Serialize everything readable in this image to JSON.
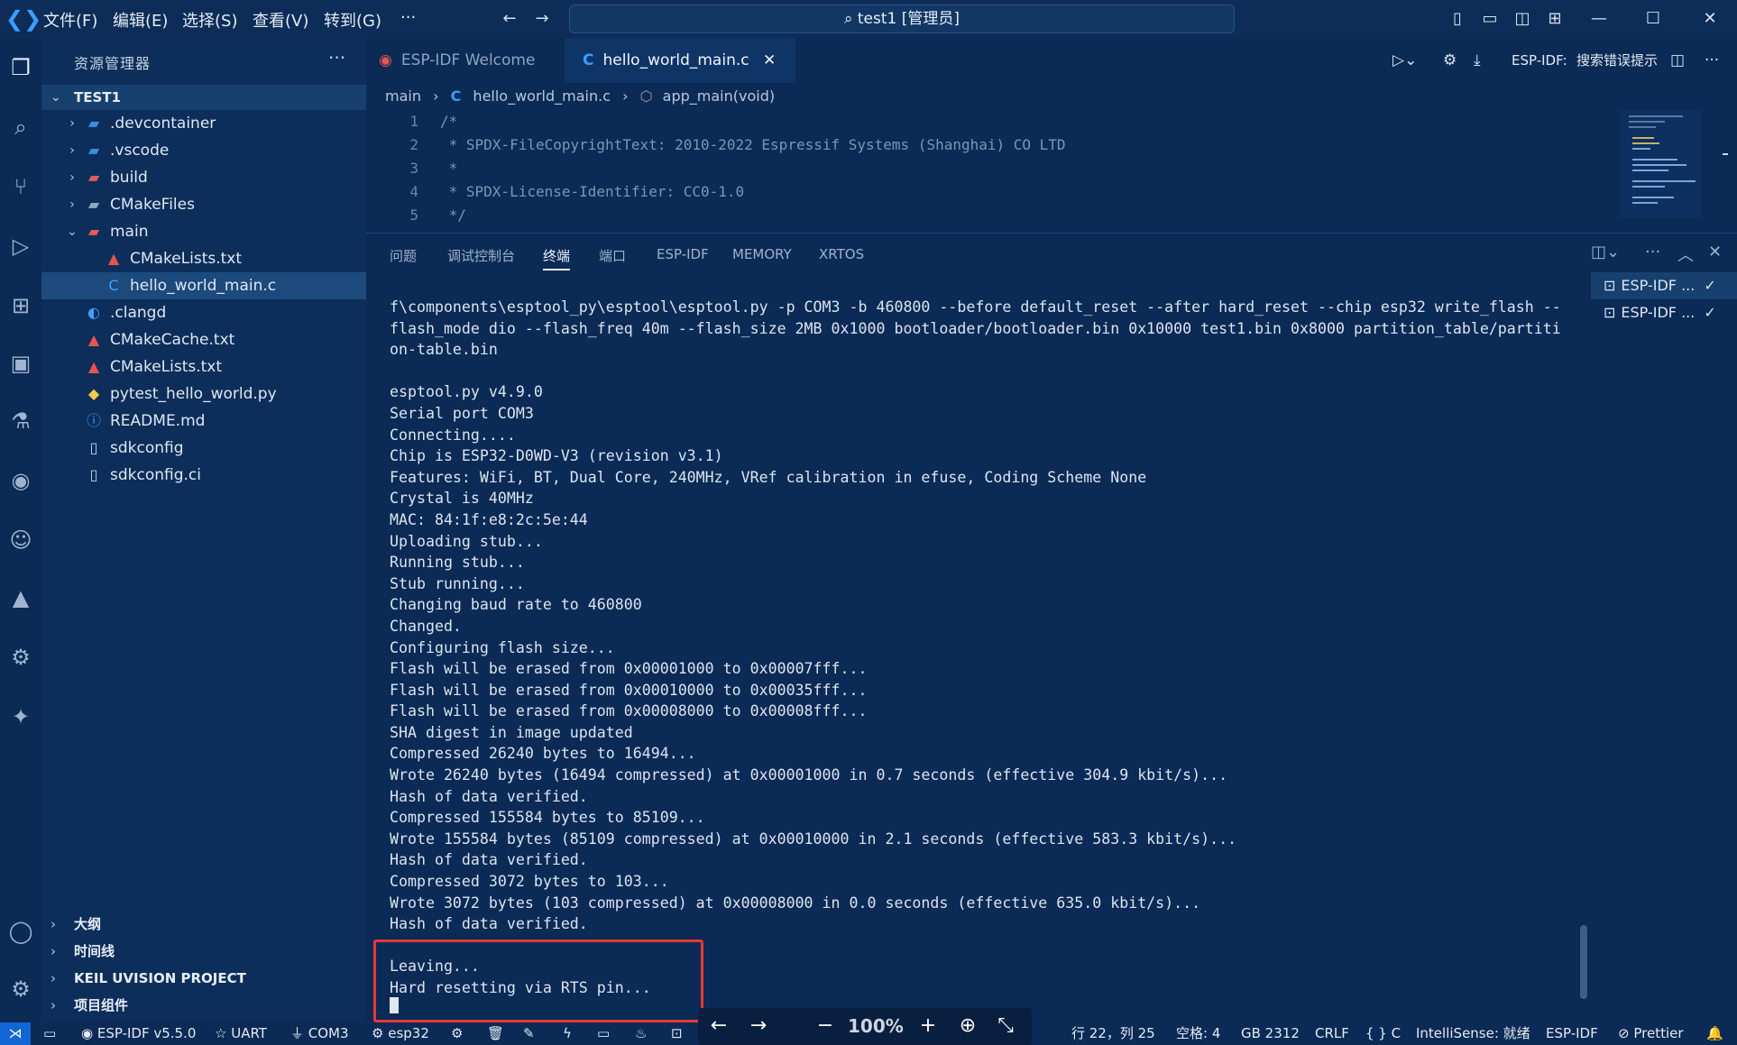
{
  "titlebar": {
    "menus": [
      "文件(F)",
      "编辑(E)",
      "选择(S)",
      "查看(V)",
      "转到(G)",
      "···"
    ],
    "search_text": "test1 [管理员]"
  },
  "sidebar": {
    "title": "资源管理器",
    "more": "···",
    "project": "TEST1",
    "tree": [
      {
        "label": ".devcontainer",
        "type": "folder",
        "icon": "devcontainer-folder-icon",
        "color": "#3b8de0"
      },
      {
        "label": ".vscode",
        "type": "folder",
        "icon": "vscode-folder-icon",
        "color": "#3b8de0"
      },
      {
        "label": "build",
        "type": "folder",
        "icon": "build-folder-icon",
        "color": "#e05b5b"
      },
      {
        "label": "CMakeFiles",
        "type": "folder",
        "icon": "folder-icon",
        "color": "#8fa6c4"
      },
      {
        "label": "main",
        "type": "folder-open",
        "icon": "main-folder-icon",
        "color": "#e05b5b"
      },
      {
        "label": "CMakeLists.txt",
        "type": "file-nested",
        "icon": "cmake-icon",
        "color": "#e8544e"
      },
      {
        "label": "hello_world_main.c",
        "type": "file-nested",
        "icon": "c-file-icon",
        "color": "#3aa0ff"
      },
      {
        "label": ".clangd",
        "type": "file",
        "icon": "clangd-icon",
        "color": "#3aa0ff"
      },
      {
        "label": "CMakeCache.txt",
        "type": "file",
        "icon": "cmake-icon",
        "color": "#e8544e"
      },
      {
        "label": "CMakeLists.txt",
        "type": "file",
        "icon": "cmake-icon",
        "color": "#e8544e"
      },
      {
        "label": "pytest_hello_world.py",
        "type": "file",
        "icon": "python-icon",
        "color": "#f2c94c"
      },
      {
        "label": "README.md",
        "type": "file",
        "icon": "info-icon",
        "color": "#3aa0ff"
      },
      {
        "label": "sdkconfig",
        "type": "file",
        "icon": "file-icon",
        "color": "#c5d2e3"
      },
      {
        "label": "sdkconfig.ci",
        "type": "file",
        "icon": "file-icon",
        "color": "#c5d2e3"
      }
    ],
    "sections": [
      "大纲",
      "时间线",
      "KEIL UVISION PROJECT",
      "项目组件"
    ]
  },
  "tabs": {
    "welcome": "ESP-IDF Welcome",
    "active": "hello_world_main.c",
    "right_label": "ESP-IDF:",
    "right_search": "搜索错误提示"
  },
  "breadcrumb": {
    "folder": "main",
    "file": "hello_world_main.c",
    "symbol": "app_main(void)"
  },
  "code": [
    {
      "n": "1",
      "text": "/*"
    },
    {
      "n": "2",
      "text": " * SPDX-FileCopyrightText: 2010-2022 Espressif Systems (Shanghai) CO LTD"
    },
    {
      "n": "3",
      "text": " *"
    },
    {
      "n": "4",
      "text": " * SPDX-License-Identifier: CC0-1.0"
    },
    {
      "n": "5",
      "text": " */"
    }
  ],
  "panel": {
    "tabs": [
      "问题",
      "调试控制台",
      "终端",
      "端口",
      "ESP-IDF",
      "MEMORY",
      "XRTOS"
    ],
    "active_tab": "终端",
    "terminals": [
      "ESP-IDF ...",
      "ESP-IDF ..."
    ]
  },
  "terminal": [
    "f\\components\\esptool_py\\esptool\\esptool.py -p COM3 -b 460800 --before default_reset --after hard_reset --chip esp32 write_flash --",
    "flash_mode dio --flash_freq 40m --flash_size 2MB 0x1000 bootloader/bootloader.bin 0x10000 test1.bin 0x8000 partition_table/partiti",
    "on-table.bin",
    "",
    "esptool.py v4.9.0",
    "Serial port COM3",
    "Connecting....",
    "Chip is ESP32-D0WD-V3 (revision v3.1)",
    "Features: WiFi, BT, Dual Core, 240MHz, VRef calibration in efuse, Coding Scheme None",
    "Crystal is 40MHz",
    "MAC: 84:1f:e8:2c:5e:44",
    "Uploading stub...",
    "Running stub...",
    "Stub running...",
    "Changing baud rate to 460800",
    "Changed.",
    "Configuring flash size...",
    "Flash will be erased from 0x00001000 to 0x00007fff...",
    "Flash will be erased from 0x00010000 to 0x00035fff...",
    "Flash will be erased from 0x00008000 to 0x00008fff...",
    "SHA digest in image updated",
    "Compressed 26240 bytes to 16494...",
    "Wrote 26240 bytes (16494 compressed) at 0x00001000 in 0.7 seconds (effective 304.9 kbit/s)...",
    "Hash of data verified.",
    "Compressed 155584 bytes to 85109...",
    "Wrote 155584 bytes (85109 compressed) at 0x00010000 in 2.1 seconds (effective 583.3 kbit/s)...",
    "Hash of data verified.",
    "Compressed 3072 bytes to 103...",
    "Wrote 3072 bytes (103 compressed) at 0x00008000 in 0.0 seconds (effective 635.0 kbit/s)...",
    "Hash of data verified.",
    "",
    "Leaving...",
    "Hard resetting via RTS pin..."
  ],
  "statusbar": {
    "idf_version": "ESP-IDF v5.5.0",
    "uart": "UART",
    "port": "COM3",
    "target": "esp32",
    "position": "行 22，列 25",
    "spaces": "空格: 4",
    "encoding": "GB 2312",
    "eol": "CRLF",
    "language": "{ } C",
    "intellisense": "IntelliSense: 就绪",
    "idf": "ESP-IDF",
    "prettier": "Prettier",
    "zoom": "100%"
  },
  "colors": {
    "background": "#0b2a55",
    "accent": "#1266d6",
    "highlight_box": "#e53935"
  }
}
